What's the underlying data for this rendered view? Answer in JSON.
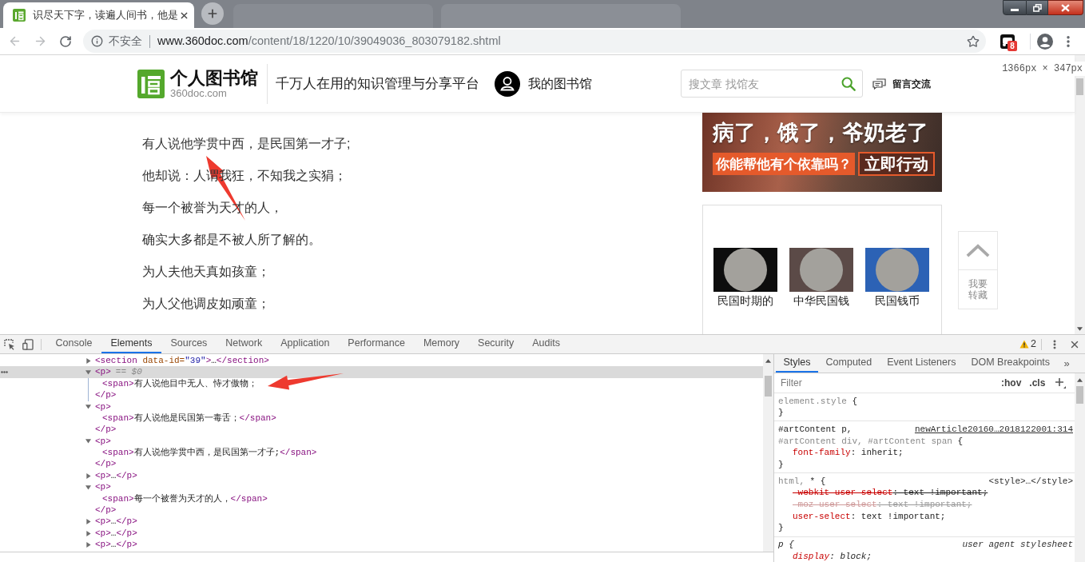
{
  "browser": {
    "tabs": [
      {
        "title": "识尽天下字，读遍人间书，他是",
        "selected": true
      }
    ],
    "address": {
      "security": "不安全",
      "host": "www.360doc.com",
      "path": "/content/18/1220/10/39049036_803079182.shtml"
    },
    "extension_badge": "8"
  },
  "page": {
    "header": {
      "logo_title": "个人图书馆",
      "logo_domain": "360doc.com",
      "slogan": "千万人在用的知识管理与分享平台",
      "my_library": "我的图书馆",
      "search": {
        "placeholder": "搜文章 找馆友"
      },
      "message": "留言交流"
    },
    "viewport_size": "1366px × 347px",
    "article_lines": [
      "有人说他学贯中西，是民国第一才子;",
      "他却说：人谓我狂，不知我之实狷；",
      "每一个被誉为天才的人，",
      "确实大多都是不被人所了解的。",
      "为人夫他天真如孩童；",
      "为人父他调皮如顽童；"
    ],
    "ad": {
      "headline": "病了，饿了，爷奶老了",
      "subline": "你能帮他有个依靠吗？",
      "action": "立即行动"
    },
    "related": [
      {
        "caption": "民国时期的"
      },
      {
        "caption": "中华民国钱"
      },
      {
        "caption": "民国钱币"
      }
    ],
    "save_label": "我要转藏"
  },
  "devtools": {
    "tabs": [
      {
        "label": "Console",
        "selected": false
      },
      {
        "label": "Elements",
        "selected": true
      },
      {
        "label": "Sources",
        "selected": false
      },
      {
        "label": "Network",
        "selected": false
      },
      {
        "label": "Application",
        "selected": false
      },
      {
        "label": "Performance",
        "selected": false
      },
      {
        "label": "Memory",
        "selected": false
      },
      {
        "label": "Security",
        "selected": false
      },
      {
        "label": "Audits",
        "selected": false
      }
    ],
    "warnings": "2",
    "dom_tree": [
      {
        "parts": [
          {
            "kind": "tag",
            "text": "<section"
          },
          {
            "kind": "attr",
            "text": " data-id="
          },
          {
            "kind": "value",
            "text": "\"39\""
          },
          {
            "kind": "tag",
            "text": ">"
          },
          {
            "kind": "text",
            "text": "…"
          },
          {
            "kind": "tag",
            "text": "</section>"
          }
        ],
        "expanded": false,
        "selected": false
      },
      {
        "parts": [
          {
            "kind": "tag",
            "text": "<p>"
          },
          {
            "kind": "marker",
            "text": "== $0"
          }
        ],
        "expanded": true,
        "selected": true,
        "children": [
          {
            "parts": [
              {
                "kind": "tag",
                "text": "<span>"
              },
              {
                "kind": "text",
                "text": "有人说他目中无人、恃才傲物；"
              }
            ],
            "selected": false
          }
        ],
        "close": [
          {
            "kind": "tag",
            "text": "</p>"
          }
        ]
      },
      {
        "parts": [
          {
            "kind": "tag",
            "text": "<p>"
          }
        ],
        "expanded": true,
        "selected": false,
        "children": [
          {
            "parts": [
              {
                "kind": "tag",
                "text": "<span>"
              },
              {
                "kind": "text",
                "text": "有人说他是民国第一毒舌；"
              },
              {
                "kind": "tag",
                "text": "</span>"
              }
            ],
            "selected": false
          }
        ],
        "close": [
          {
            "kind": "tag",
            "text": "</p>"
          }
        ]
      },
      {
        "parts": [
          {
            "kind": "tag",
            "text": "<p>"
          }
        ],
        "expanded": true,
        "selected": false,
        "children": [
          {
            "parts": [
              {
                "kind": "tag",
                "text": "<span>"
              },
              {
                "kind": "text",
                "text": "有人说他学贯中西，是民国第一才子;"
              },
              {
                "kind": "tag",
                "text": "</span>"
              }
            ],
            "selected": false
          }
        ],
        "close": [
          {
            "kind": "tag",
            "text": "</p>"
          }
        ]
      },
      {
        "parts": [
          {
            "kind": "tag",
            "text": "<p>"
          },
          {
            "kind": "text",
            "text": "…"
          },
          {
            "kind": "tag",
            "text": "</p>"
          }
        ],
        "expanded": false,
        "selected": false
      },
      {
        "parts": [
          {
            "kind": "tag",
            "text": "<p>"
          }
        ],
        "expanded": true,
        "selected": false,
        "children": [
          {
            "parts": [
              {
                "kind": "tag",
                "text": "<span>"
              },
              {
                "kind": "text",
                "text": "每一个被誉为天才的人，"
              },
              {
                "kind": "tag",
                "text": "</span>"
              }
            ],
            "selected": false
          }
        ],
        "close": [
          {
            "kind": "tag",
            "text": "</p>"
          }
        ]
      },
      {
        "parts": [
          {
            "kind": "tag",
            "text": "<p>"
          },
          {
            "kind": "text",
            "text": "…"
          },
          {
            "kind": "tag",
            "text": "</p>"
          }
        ],
        "expanded": false,
        "selected": false
      },
      {
        "parts": [
          {
            "kind": "tag",
            "text": "<p>"
          },
          {
            "kind": "text",
            "text": "…"
          },
          {
            "kind": "tag",
            "text": "</p>"
          }
        ],
        "expanded": false,
        "selected": false
      },
      {
        "parts": [
          {
            "kind": "tag",
            "text": "<p>"
          },
          {
            "kind": "text",
            "text": "…"
          },
          {
            "kind": "tag",
            "text": "</p>"
          }
        ],
        "expanded": false,
        "selected": false
      }
    ],
    "styles": {
      "tabs": [
        {
          "label": "Styles",
          "selected": true
        },
        {
          "label": "Computed",
          "selected": false
        },
        {
          "label": "Event Listeners",
          "selected": false
        },
        {
          "label": "DOM Breakpoints",
          "selected": false
        }
      ],
      "overflow": "»",
      "filter": {
        "placeholder": "Filter"
      },
      "toggles": [
        ":hov",
        ".cls"
      ],
      "rules": [
        {
          "selector_lines": [
            [
              {
                "kind": "nomatch",
                "text": "element.style"
              },
              {
                "kind": "plain",
                "text": " {"
              }
            ]
          ],
          "close": "}"
        },
        {
          "selector_lines": [
            [
              {
                "kind": "match",
                "text": "#artContent p"
              },
              {
                "kind": "plain",
                "text": ","
              }
            ],
            [
              {
                "kind": "nomatch",
                "text": "#artContent div, #artContent span"
              },
              {
                "kind": "plain",
                "text": " {"
              }
            ]
          ],
          "source": {
            "kind": "link",
            "text": "newArticle20160…2018122001:314"
          },
          "declarations": [
            {
              "name": "font-family",
              "rest": ": inherit;",
              "overridden": false,
              "invalid": false
            }
          ],
          "close": "}"
        },
        {
          "selector_lines": [
            [
              {
                "kind": "nomatch",
                "text": "html,"
              },
              {
                "kind": "match",
                "text": " *"
              },
              {
                "kind": "plain",
                "text": " {"
              }
            ]
          ],
          "source": {
            "kind": "style",
            "text": "<style>…</style>"
          },
          "declarations": [
            {
              "name": "-webkit-user-select",
              "rest": ": text !important;",
              "overridden": true,
              "invalid": false
            },
            {
              "name": "-moz-user-select",
              "rest": ": text !important;",
              "overridden": true,
              "invalid": true
            },
            {
              "name": "user-select",
              "rest": ": text !important;",
              "overridden": false,
              "invalid": false
            }
          ],
          "close": "}"
        },
        {
          "selector_lines": [
            [
              {
                "kind": "match",
                "text": "p"
              },
              {
                "kind": "plain",
                "text": " {"
              }
            ]
          ],
          "source": {
            "kind": "user-agent",
            "text": "user agent stylesheet"
          },
          "declarations": [
            {
              "name": "display",
              "rest": ": block;",
              "overridden": false,
              "invalid": false
            }
          ]
        }
      ]
    }
  }
}
